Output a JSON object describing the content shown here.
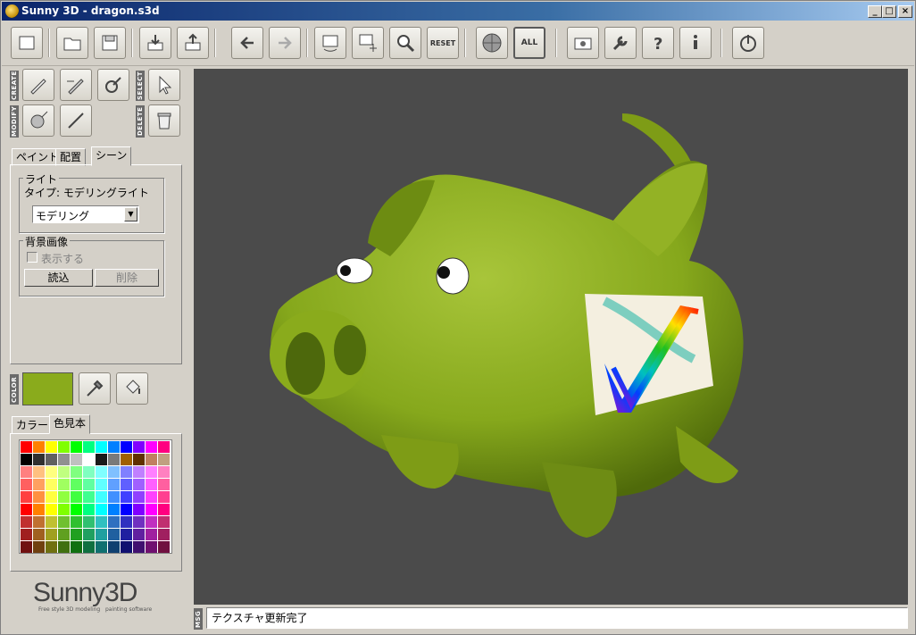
{
  "window": {
    "title": "Sunny 3D - dragon.s3d"
  },
  "toolbar": {
    "items": [
      "new-icon",
      "open-icon",
      "save-icon",
      "import-icon",
      "export-icon",
      "undo-icon",
      "redo-icon",
      "rotate-view-icon",
      "pan-view-icon",
      "zoom-icon",
      "reset-icon",
      "shading-sphere-icon",
      "fit-all-icon",
      "camera-icon",
      "wrench-icon",
      "help-icon",
      "info-icon",
      "power-icon"
    ],
    "reset_label": "RESET",
    "all_label": "ALL"
  },
  "tools": {
    "create_label": "CREATE",
    "select_label": "SELECT",
    "modify_label": "MODIFY",
    "delete_label": "DELETE"
  },
  "tabs": {
    "paint": "ペイント",
    "layout": "配置",
    "scene": "シーン"
  },
  "scene": {
    "light_group": "ライト",
    "light_type": "タイプ: モデリングライト",
    "light_select": "モデリング",
    "bg_group": "背景画像",
    "show_label": "表示する",
    "load_button": "読込",
    "delete_button": "削除"
  },
  "color": {
    "label": "COLOR",
    "current": "#8aab1c"
  },
  "palette_tabs": {
    "color": "カラー",
    "swatches": "色見本"
  },
  "swatches": [
    "#ff0000",
    "#ff8000",
    "#ffff00",
    "#80ff00",
    "#00ff00",
    "#00ff80",
    "#00ffff",
    "#0080ff",
    "#0000ff",
    "#8000ff",
    "#ff00ff",
    "#ff0080",
    "#000000",
    "#303030",
    "#606060",
    "#909090",
    "#c0c0c0",
    "#ffffff",
    "#1a1a1a",
    "#7a7a7a",
    "#a06000",
    "#603000",
    "#c08060",
    "#c0a080",
    "#ff8080",
    "#ffc080",
    "#ffff80",
    "#c0ff80",
    "#80ff80",
    "#80ffc0",
    "#80ffff",
    "#80c0ff",
    "#8080ff",
    "#c080ff",
    "#ff80ff",
    "#ff80c0",
    "#ff6060",
    "#ffa060",
    "#ffff60",
    "#a0ff60",
    "#60ff60",
    "#60ffa0",
    "#60ffff",
    "#60a0ff",
    "#6060ff",
    "#a060ff",
    "#ff60ff",
    "#ff60a0",
    "#ff4040",
    "#ff9040",
    "#ffff40",
    "#90ff40",
    "#40ff40",
    "#40ff90",
    "#40ffff",
    "#4090ff",
    "#4040ff",
    "#9040ff",
    "#ff40ff",
    "#ff4090",
    "#ff0000",
    "#ff8000",
    "#ffff00",
    "#80ff00",
    "#00ff00",
    "#00ff80",
    "#00ffff",
    "#0080ff",
    "#0000ff",
    "#8000ff",
    "#ff00ff",
    "#ff0080",
    "#c03030",
    "#c07030",
    "#c0c030",
    "#70c030",
    "#30c030",
    "#30c070",
    "#30c0c0",
    "#3070c0",
    "#3030c0",
    "#7030c0",
    "#c030c0",
    "#c03070",
    "#a02020",
    "#a06020",
    "#a0a020",
    "#60a020",
    "#20a020",
    "#20a060",
    "#20a0a0",
    "#2060a0",
    "#2020a0",
    "#6020a0",
    "#a020a0",
    "#a02060",
    "#701010",
    "#704010",
    "#707010",
    "#407010",
    "#107010",
    "#107040",
    "#107070",
    "#104070",
    "#101070",
    "#401070",
    "#701070",
    "#701040"
  ],
  "brand": {
    "name": "Sunny3D",
    "tagline": "Free style 3D modeling   painting software"
  },
  "status": {
    "msg_label": "MSG",
    "message": "テクスチャ更新完了"
  }
}
